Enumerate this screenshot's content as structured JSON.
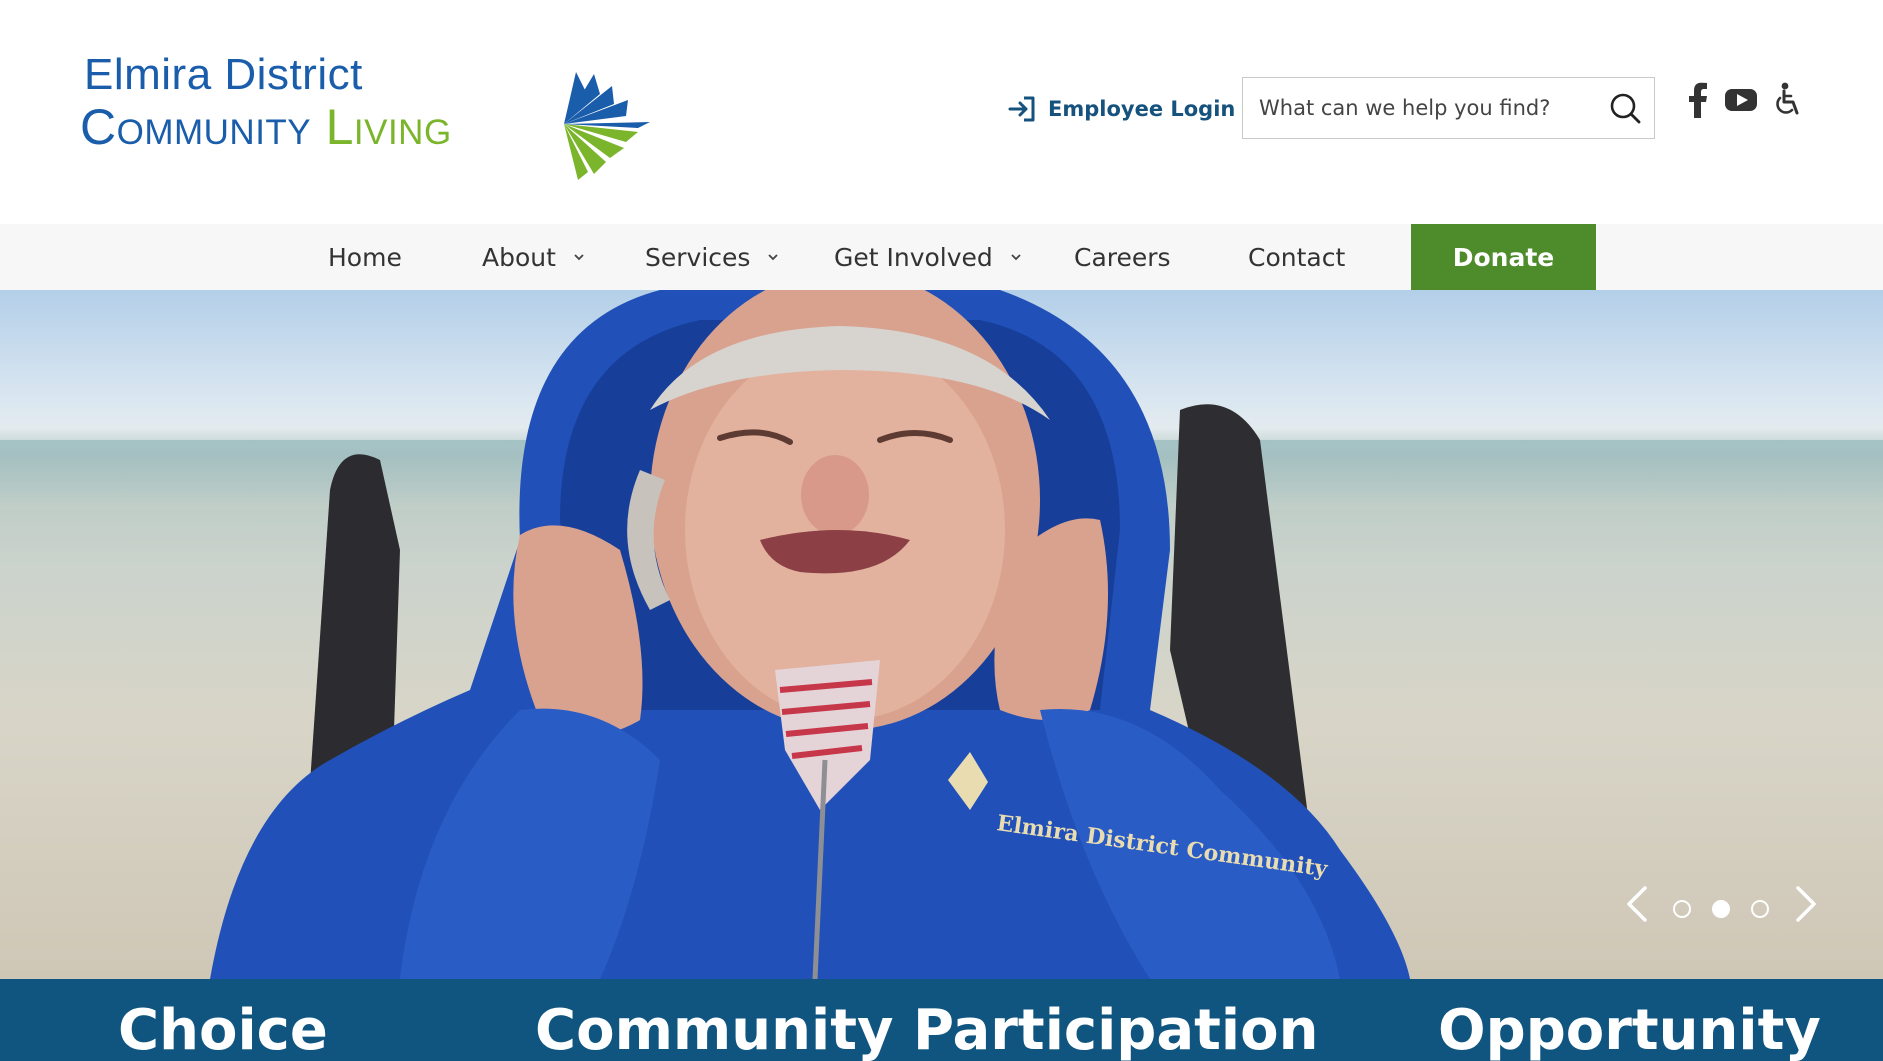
{
  "header": {
    "logo": {
      "line1": "Elmira District",
      "line2_word1": "Community",
      "line2_word2": "Living",
      "colors": {
        "blue": "#1a5dab",
        "green": "#7ab52c"
      }
    },
    "employee_login": {
      "label": "Employee Login",
      "icon": "login-arrow-icon"
    },
    "search": {
      "placeholder": "What can we help you find?",
      "value": "",
      "icon": "search-icon"
    },
    "social": [
      {
        "name": "facebook-icon"
      },
      {
        "name": "youtube-icon"
      },
      {
        "name": "accessibility-icon"
      }
    ]
  },
  "nav": {
    "items": [
      {
        "label": "Home",
        "has_dropdown": false
      },
      {
        "label": "About",
        "has_dropdown": true
      },
      {
        "label": "Services",
        "has_dropdown": true
      },
      {
        "label": "Get Involved",
        "has_dropdown": true
      },
      {
        "label": "Careers",
        "has_dropdown": false
      },
      {
        "label": "Contact",
        "has_dropdown": false
      }
    ],
    "donate_label": "Donate",
    "donate_color": "#4d8b2b"
  },
  "hero": {
    "slide_count": 3,
    "active_slide": 2,
    "jacket_logo_text": "Elmira District Community"
  },
  "values": {
    "background": "#0f5580",
    "items": [
      "Choice",
      "Community Participation",
      "Opportunity"
    ]
  }
}
